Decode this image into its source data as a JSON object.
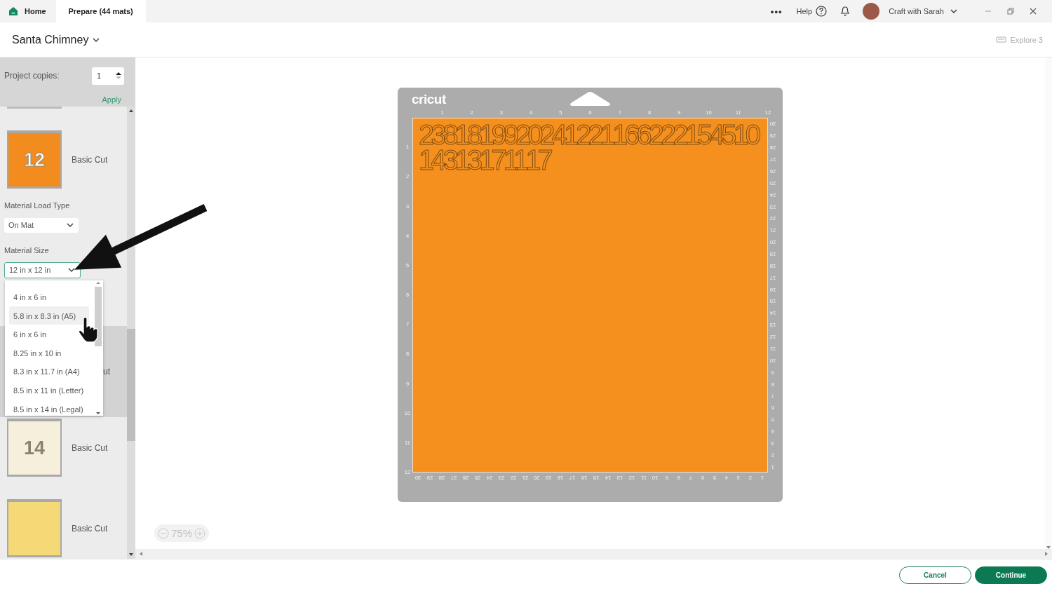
{
  "topbar": {
    "tabs": [
      {
        "label": "Home",
        "kind": "home",
        "selected": false
      },
      {
        "label": "Prepare (44 mats)",
        "kind": "plain",
        "selected": true
      }
    ],
    "more": "•••",
    "help": "Help",
    "account": "Craft with Sarah"
  },
  "header": {
    "project_title": "Santa Chimney",
    "machine": "Explore 3"
  },
  "sidebar": {
    "copies_label": "Project copies:",
    "copies_value": "1",
    "apply": "Apply",
    "mats": [
      {
        "thumb": "12",
        "color": "#f28c1f",
        "label": "Basic Cut",
        "selected": false,
        "load_type": {
          "label": "Material Load Type",
          "value": "On Mat"
        },
        "size": {
          "label": "Material Size",
          "value": "12 in x 12 in",
          "open": true,
          "options": [
            {
              "label": "4 in x 6 in",
              "highlighted": false
            },
            {
              "label": "5.8 in x 8.3 in (A5)",
              "highlighted": true
            },
            {
              "label": "6 in x 6 in",
              "highlighted": false
            },
            {
              "label": "8.25 in x 10 in",
              "highlighted": false
            },
            {
              "label": "8.3 in x 11.7 in (A4)",
              "highlighted": false
            },
            {
              "label": "8.5 in x 11 in (Letter)",
              "highlighted": false
            },
            {
              "label": "8.5 in x 14 in (Legal)",
              "highlighted": false
            }
          ]
        }
      },
      {
        "label": "ut",
        "covered": true,
        "selected": true
      },
      {
        "thumb": "14",
        "color": "#f6efdc",
        "label": "Basic Cut",
        "selected": false
      },
      {
        "color": "#f6d977",
        "label": "Basic Cut",
        "selected": false
      }
    ]
  },
  "canvas": {
    "mat": {
      "brand": "cricut",
      "top_ruler": [
        "1",
        "2",
        "3",
        "4",
        "5",
        "6",
        "7",
        "8",
        "9",
        "10",
        "11",
        "12"
      ],
      "left_ruler": [
        "1",
        "2",
        "3",
        "4",
        "5",
        "6",
        "7",
        "8",
        "9",
        "10",
        "11",
        "12"
      ],
      "right_ruler": [
        "30",
        "29",
        "28",
        "27",
        "26",
        "25",
        "24",
        "23",
        "22",
        "21",
        "20",
        "19",
        "18",
        "17",
        "16",
        "15",
        "14",
        "13",
        "12",
        "11",
        "10",
        "9",
        "8",
        "7",
        "6",
        "5",
        "4",
        "3",
        "2",
        "1"
      ],
      "bottom_ruler": [
        "30",
        "29",
        "28",
        "27",
        "26",
        "25",
        "24",
        "23",
        "22",
        "21",
        "20",
        "19",
        "18",
        "17",
        "16",
        "15",
        "14",
        "13",
        "12",
        "11",
        "10",
        "9",
        "8",
        "7",
        "6",
        "5",
        "4",
        "3",
        "2",
        "1"
      ],
      "rows": [
        [
          "23",
          "8",
          "18",
          "19",
          "9",
          "20",
          "24",
          "12",
          "21",
          "16",
          "6",
          "22",
          "2",
          "15",
          "4",
          "5",
          "10"
        ],
        [
          "14",
          "3",
          "13",
          "17",
          "11",
          "1",
          "7"
        ]
      ]
    },
    "zoom": "75%"
  },
  "footer": {
    "buttons": [
      {
        "label": "Cancel",
        "kind": "secondary"
      },
      {
        "label": "Continue",
        "kind": "primary"
      }
    ]
  }
}
